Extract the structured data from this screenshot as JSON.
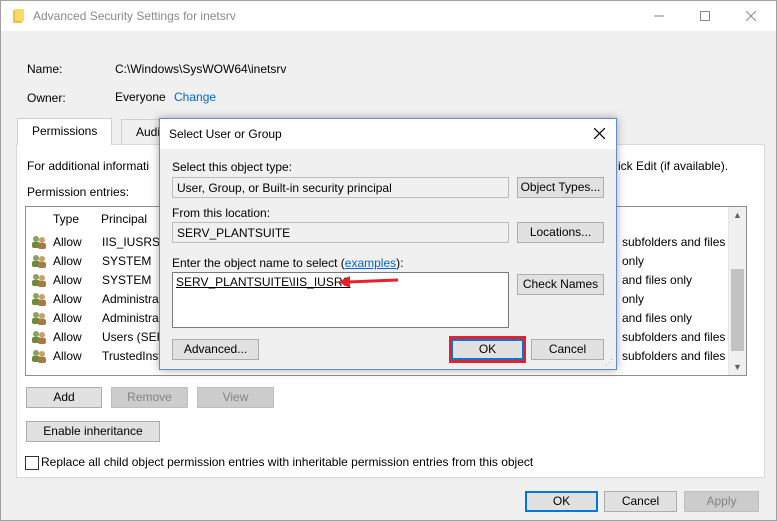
{
  "window": {
    "title": "Advanced Security Settings for inetsrv",
    "name_label": "Name:",
    "name_value": "C:\\Windows\\SysWOW64\\inetsrv",
    "owner_label": "Owner:",
    "owner_value": "Everyone",
    "owner_change": "Change",
    "tabs": [
      "Permissions",
      "Audi"
    ],
    "info_text_left": "For additional informati",
    "info_text_right": "ick Edit (if available).",
    "entries_label": "Permission entries:",
    "columns": [
      "Type",
      "Principal"
    ],
    "rows": [
      {
        "type": "Allow",
        "principal": "IIS_IUSRS (S",
        "tail": "subfolders and files"
      },
      {
        "type": "Allow",
        "principal": "SYSTEM",
        "tail": "only"
      },
      {
        "type": "Allow",
        "principal": "SYSTEM",
        "tail": "and files only"
      },
      {
        "type": "Allow",
        "principal": "Administra",
        "tail": "only"
      },
      {
        "type": "Allow",
        "principal": "Administra",
        "tail": "and files only"
      },
      {
        "type": "Allow",
        "principal": "Users (SER",
        "tail": "subfolders and files"
      },
      {
        "type": "Allow",
        "principal": "TrustedInst",
        "tail": "subfolders and files"
      }
    ],
    "btn_add": "Add",
    "btn_remove": "Remove",
    "btn_view": "View",
    "btn_enable_inheritance": "Enable inheritance",
    "replace_label": "Replace all child object permission entries with inheritable permission entries from this object",
    "btn_ok": "OK",
    "btn_cancel": "Cancel",
    "btn_apply": "Apply"
  },
  "dialog": {
    "title": "Select User or Group",
    "object_type_label": "Select this object type:",
    "object_type_value": "User, Group, or Built-in security principal",
    "btn_object_types": "Object Types...",
    "location_label": "From this location:",
    "location_value": "SERV_PLANTSUITE",
    "btn_locations": "Locations...",
    "enter_label_pre": "Enter the object name to select (",
    "enter_label_link": "examples",
    "enter_label_post": "):",
    "object_name_value": "SERV_PLANTSUITE\\IIS_IUSRS",
    "btn_check_names": "Check Names",
    "btn_advanced": "Advanced...",
    "btn_ok": "OK",
    "btn_cancel": "Cancel"
  },
  "colors": {
    "highlight": "#e8202a",
    "link": "#0066cc",
    "focus": "#0078d7"
  }
}
